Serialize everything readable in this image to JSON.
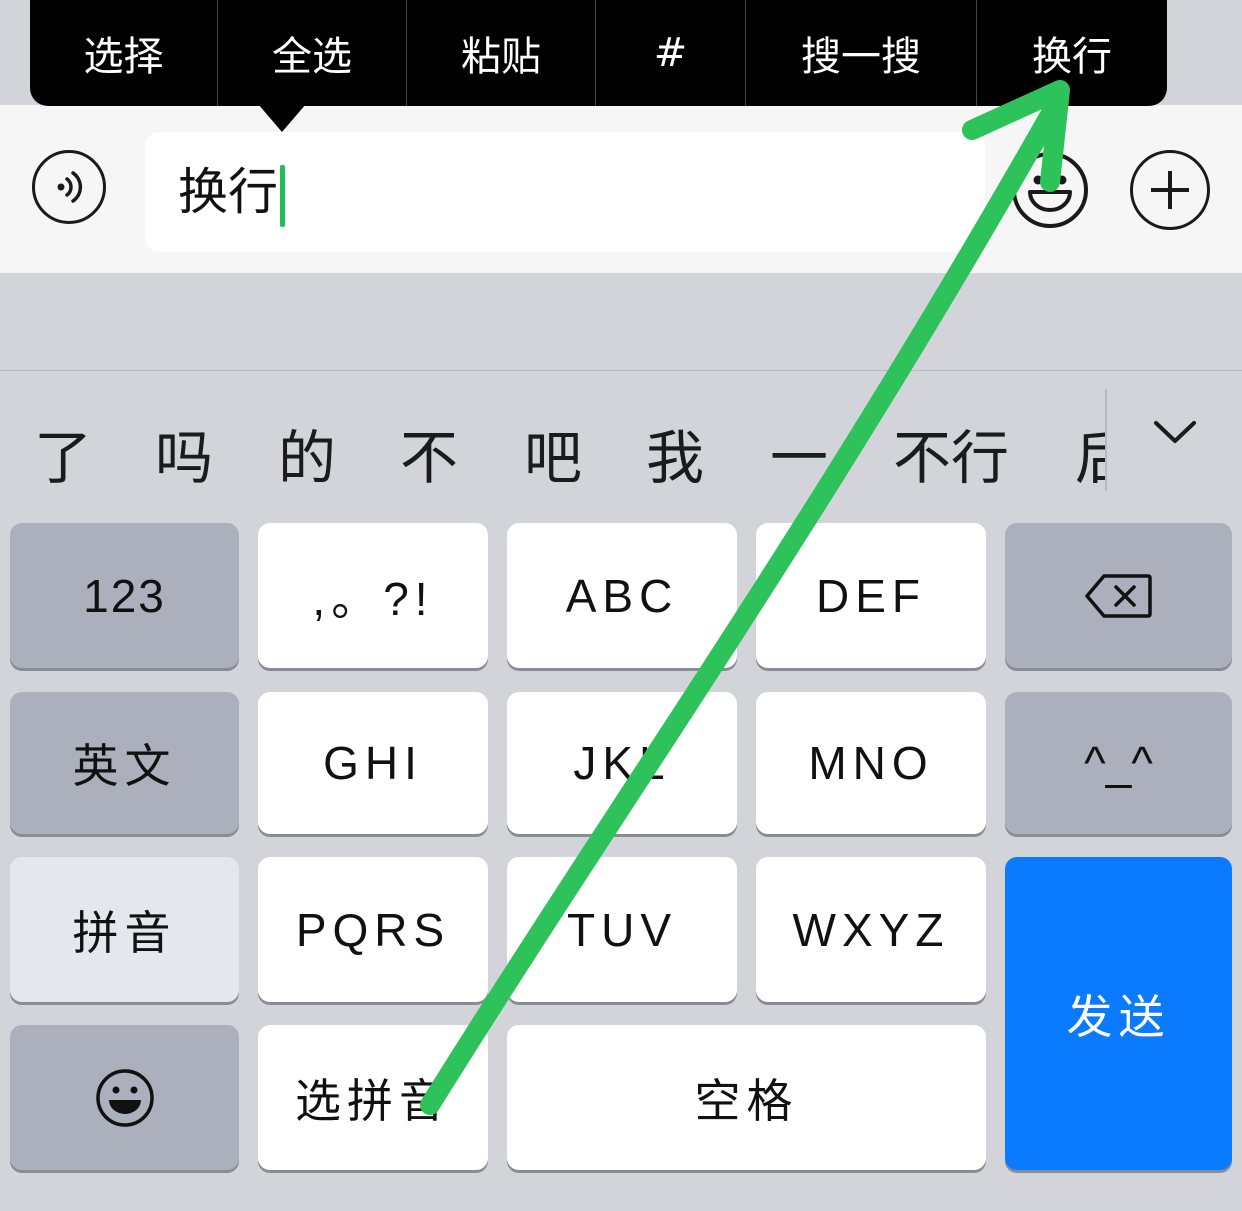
{
  "context_menu": {
    "items": [
      "选择",
      "全选",
      "粘贴",
      "#",
      "搜一搜",
      "换行"
    ]
  },
  "input_bar": {
    "text_value": "换行",
    "voice_icon": "voice-icon",
    "emoji_icon": "emoji-icon",
    "plus_icon": "plus-icon"
  },
  "candidates": {
    "items": [
      "了",
      "吗",
      "的",
      "不",
      "吧",
      "我",
      "一",
      "不行"
    ],
    "partial": "后",
    "expand_icon": "chevron-down-icon"
  },
  "keyboard": {
    "row1": {
      "num": "123",
      "punct": ",。?!",
      "abc": "ABC",
      "def": "DEF",
      "delete_icon": "backspace-icon"
    },
    "row2": {
      "english": "英文",
      "ghi": "GHI",
      "jkl": "JKL",
      "mno": "MNO",
      "emoticon": "^_^"
    },
    "row3": {
      "pinyin": "拼音",
      "pqrs": "PQRS",
      "tuv": "TUV",
      "wxyz": "WXYZ"
    },
    "row4": {
      "emoji_icon": "smiley-icon",
      "select_pinyin": "选拼音",
      "space": "空格"
    },
    "send": "发送"
  },
  "annotation": {
    "arrow_color": "#2ec35a",
    "icon": "green-arrow-annotation"
  },
  "colors": {
    "send_key": "#0a7aff",
    "caret": "#1fbe5a"
  }
}
